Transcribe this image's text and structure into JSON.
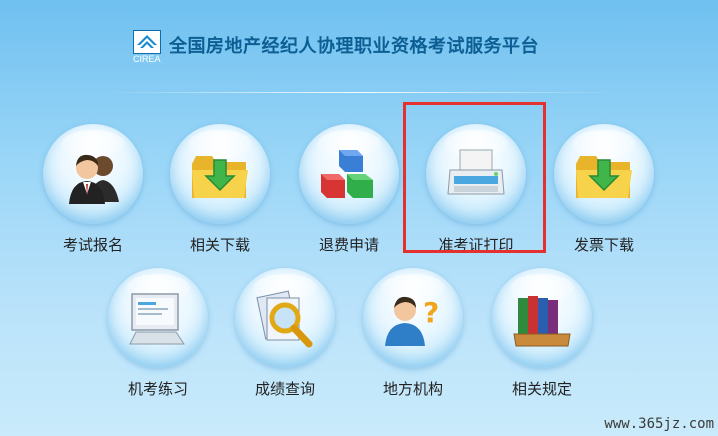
{
  "header": {
    "logo_text": "CIREA",
    "title": "全国房地产经纪人协理职业资格考试服务平台"
  },
  "tiles_row1": [
    {
      "label": "考试报名",
      "icon": "users-icon"
    },
    {
      "label": "相关下载",
      "icon": "folder-download-icon"
    },
    {
      "label": "退费申请",
      "icon": "cubes-icon"
    },
    {
      "label": "准考证打印",
      "icon": "printer-icon"
    },
    {
      "label": "发票下载",
      "icon": "folder-download-icon"
    }
  ],
  "tiles_row2": [
    {
      "label": "机考练习",
      "icon": "computer-icon"
    },
    {
      "label": "成绩查询",
      "icon": "magnifier-icon"
    },
    {
      "label": "地方机构",
      "icon": "person-question-icon"
    },
    {
      "label": "相关规定",
      "icon": "books-icon"
    }
  ],
  "highlight_color": "#e53030",
  "watermark": "www.365jz.com"
}
